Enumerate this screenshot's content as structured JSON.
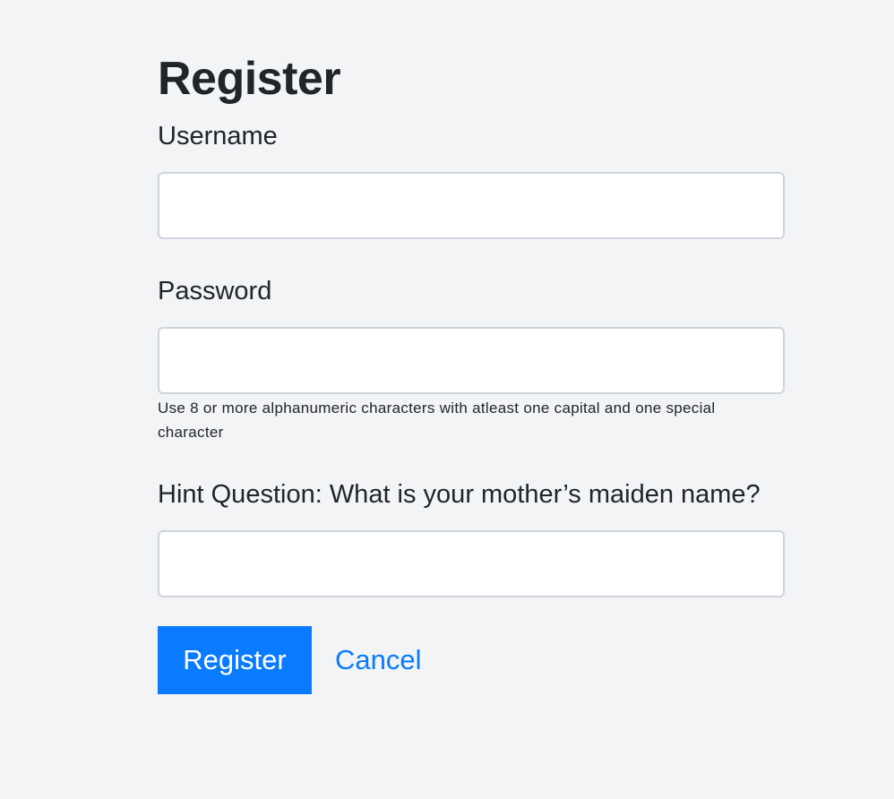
{
  "page": {
    "title": "Register"
  },
  "form": {
    "username": {
      "label": "Username",
      "value": "",
      "placeholder": ""
    },
    "password": {
      "label": "Password",
      "value": "",
      "placeholder": "",
      "help": "Use 8 or more alphanumeric characters with atleast one capital and one special character"
    },
    "hint": {
      "label": "Hint Question: What is your mother’s maiden name?",
      "value": "",
      "placeholder": ""
    }
  },
  "actions": {
    "register_label": "Register",
    "cancel_label": "Cancel"
  },
  "colors": {
    "background": "#f3f4f6",
    "primary": "#0a7bff",
    "text": "#212529",
    "input_border": "#ced4da"
  }
}
